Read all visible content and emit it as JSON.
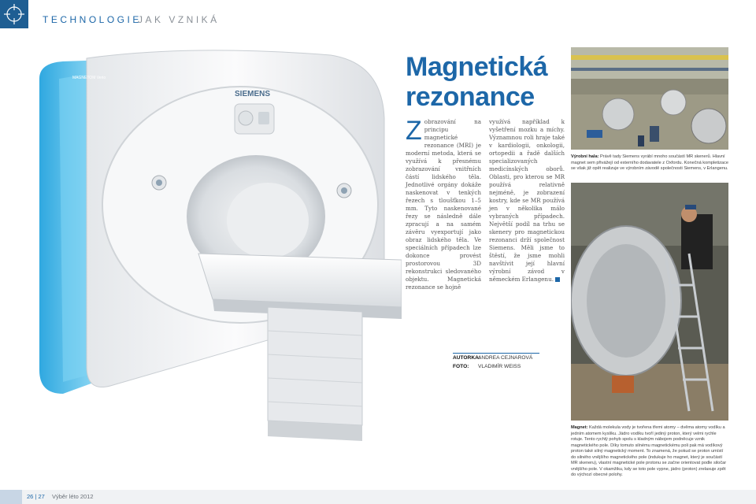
{
  "header": {
    "section": "TECHNOLOGIE",
    "subsection": "JAK VZNIKÁ"
  },
  "article": {
    "title_line1": "Magnetická",
    "title_line2": "rezonance",
    "dropcap": "Z",
    "col1_text": "obrazování na principu magnetické rezonance (MRI) je moderní metoda, která se využívá k přesnému zobrazování vnitřních částí lidského těla. Jednotlivé orgány dokáže naskenovat v tenkých řezech s tloušťkou 1–5 mm. Tyto naskenované řezy se následně dále zpracují a na samém závěru vyexportují jako obraz lidského těla. Ve speciálních případech lze dokonce provést prostorovou 3D rekonstrukci sledovaného objektu. Magnetická rezonance se hojně",
    "col2_text": "využívá například k vyšetření mozku a míchy. Významnou roli hraje také v kardiologii, onkologii, ortopedii a řadě dalších specializovaných medicínských oborů. Oblasti, pro kterou se MR používá relativně nejméně, je zobrazení kostry, kde se MR používá jen v několika málo vybraných případech. Největší podíl na trhu se skenery pro magnetickou rezonanci drží společnost Siemens. Měli jsme to štěstí, že jsme mohli navštívit její hlavní výrobní závod v německém Erlangenu."
  },
  "captions": {
    "photo1_label": "Výrobní hala:",
    "photo1_text": "Právě tady Siemens vyrábí mnoho součástí MR skenerů. Hlavní magnet sem přivážejí od externího dodavatele z Oxfordu. Konečná kompletizace se však již opět realizuje ve výrobním závodě společnosti Siemens, v Erlangenu.",
    "photo2_label": "Magnet:",
    "photo2_text": "Každá molekula vody je tvořena třemi atomy – dvěma atomy vodíku a jedním atomem kyslíku. Jádro vodíku tvoří jediný proton, který velmi rychle rotuje. Tento rychlý pohyb spolu s kladným nábojem podněcuje vznik magnetického pole. Díky tomuto silnému magnetickému poli pak má vodíkový proton také silný magnetický moment. To znamená, že pokud se proton umístí do silného vnějšího magnetického pole (indukuje ho magnet, který je součástí MR skeneru), vlastní magnetické pole protonu se začne orientovat podle siločar vnějšího pole. V okamžiku, kdy se toto pole vypne, jádro (proton) zrelaxuje zpět do výchozí obecné polohy."
  },
  "credits": {
    "author_label": "AUTORKA:",
    "author_name": "ANDREA CEJNAROVÁ",
    "photo_label": "FOTO:",
    "photo_name": "VLADIMÍR WEISS"
  },
  "mri_device": {
    "brand": "SIEMENS",
    "side_label": "MAGNETOM Verio"
  },
  "footer": {
    "pages": "26 | 27",
    "issue": "Výběr léto 2012"
  },
  "colors": {
    "accent": "#1d67a8",
    "mri_glow": "#5bc6ef"
  }
}
